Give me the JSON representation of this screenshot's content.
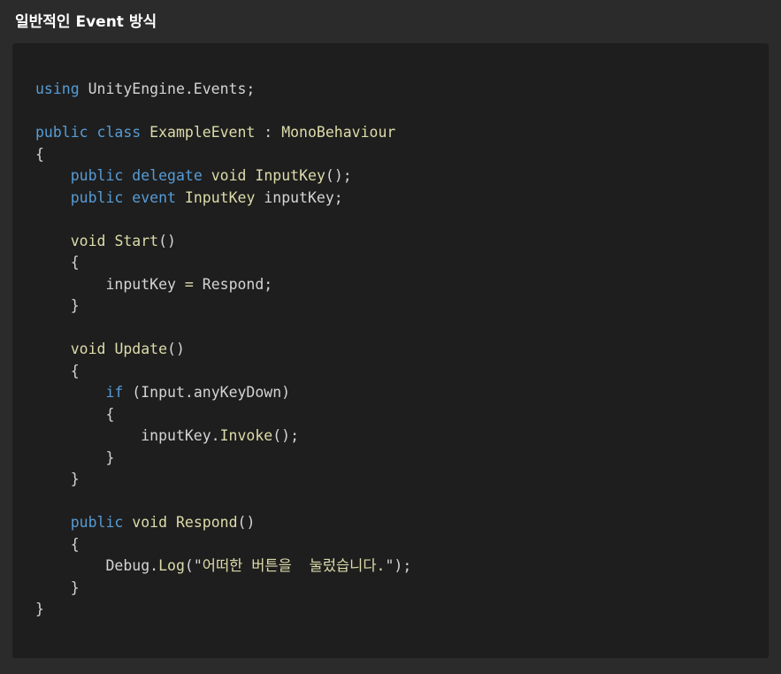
{
  "page": {
    "title": "일반적인 Event 방식"
  },
  "colors": {
    "keyword": "#569cd6",
    "identifier_highlight": "#dcdcaa",
    "plain": "#d4d4d4",
    "string": "#ce9178",
    "background": "#2b2b2b",
    "code_background": "#1e1e1e"
  },
  "code": {
    "language": "csharp",
    "lines": [
      [
        {
          "t": "using",
          "c": "kw"
        },
        {
          "t": " UnityEngine.Events;",
          "c": "plain"
        }
      ],
      [],
      [
        {
          "t": "public",
          "c": "kw"
        },
        {
          "t": " ",
          "c": "plain"
        },
        {
          "t": "class",
          "c": "kw"
        },
        {
          "t": " ",
          "c": "plain"
        },
        {
          "t": "ExampleEvent",
          "c": "type"
        },
        {
          "t": " : ",
          "c": "plain"
        },
        {
          "t": "MonoBehaviour",
          "c": "type"
        }
      ],
      [
        {
          "t": "{",
          "c": "punc"
        }
      ],
      [
        {
          "t": "    ",
          "c": "plain"
        },
        {
          "t": "public",
          "c": "kw"
        },
        {
          "t": " ",
          "c": "plain"
        },
        {
          "t": "delegate",
          "c": "kw"
        },
        {
          "t": " ",
          "c": "plain"
        },
        {
          "t": "void",
          "c": "type"
        },
        {
          "t": " ",
          "c": "plain"
        },
        {
          "t": "InputKey",
          "c": "fn"
        },
        {
          "t": "();",
          "c": "punc"
        }
      ],
      [
        {
          "t": "    ",
          "c": "plain"
        },
        {
          "t": "public",
          "c": "kw"
        },
        {
          "t": " ",
          "c": "plain"
        },
        {
          "t": "event",
          "c": "kw"
        },
        {
          "t": " ",
          "c": "plain"
        },
        {
          "t": "InputKey",
          "c": "type"
        },
        {
          "t": " inputKey;",
          "c": "plain"
        }
      ],
      [],
      [
        {
          "t": "    ",
          "c": "plain"
        },
        {
          "t": "void",
          "c": "type"
        },
        {
          "t": " ",
          "c": "plain"
        },
        {
          "t": "Start",
          "c": "fn"
        },
        {
          "t": "()",
          "c": "punc"
        }
      ],
      [
        {
          "t": "    {",
          "c": "punc"
        }
      ],
      [
        {
          "t": "        inputKey ",
          "c": "plain"
        },
        {
          "t": "=",
          "c": "type"
        },
        {
          "t": " Respond;",
          "c": "plain"
        }
      ],
      [
        {
          "t": "    }",
          "c": "punc"
        }
      ],
      [],
      [
        {
          "t": "    ",
          "c": "plain"
        },
        {
          "t": "void",
          "c": "type"
        },
        {
          "t": " ",
          "c": "plain"
        },
        {
          "t": "Update",
          "c": "fn"
        },
        {
          "t": "()",
          "c": "punc"
        }
      ],
      [
        {
          "t": "    {",
          "c": "punc"
        }
      ],
      [
        {
          "t": "        ",
          "c": "plain"
        },
        {
          "t": "if",
          "c": "kw"
        },
        {
          "t": " (Input.anyKeyDown)",
          "c": "plain"
        }
      ],
      [
        {
          "t": "        {",
          "c": "punc"
        }
      ],
      [
        {
          "t": "            inputKey.",
          "c": "plain"
        },
        {
          "t": "Invoke",
          "c": "fn"
        },
        {
          "t": "();",
          "c": "punc"
        }
      ],
      [
        {
          "t": "        }",
          "c": "punc"
        }
      ],
      [
        {
          "t": "    }",
          "c": "punc"
        }
      ],
      [],
      [
        {
          "t": "    ",
          "c": "plain"
        },
        {
          "t": "public",
          "c": "kw"
        },
        {
          "t": " ",
          "c": "plain"
        },
        {
          "t": "void",
          "c": "type"
        },
        {
          "t": " ",
          "c": "plain"
        },
        {
          "t": "Respond",
          "c": "fn"
        },
        {
          "t": "()",
          "c": "punc"
        }
      ],
      [
        {
          "t": "    {",
          "c": "punc"
        }
      ],
      [
        {
          "t": "        Debug.",
          "c": "plain"
        },
        {
          "t": "Log",
          "c": "fn"
        },
        {
          "t": "(\"",
          "c": "plain"
        },
        {
          "t": "어떠한 버튼을  눌렀습니다.",
          "c": "fn"
        },
        {
          "t": "\");",
          "c": "plain"
        }
      ],
      [
        {
          "t": "    }",
          "c": "punc"
        }
      ],
      [
        {
          "t": "}",
          "c": "punc"
        }
      ]
    ]
  }
}
